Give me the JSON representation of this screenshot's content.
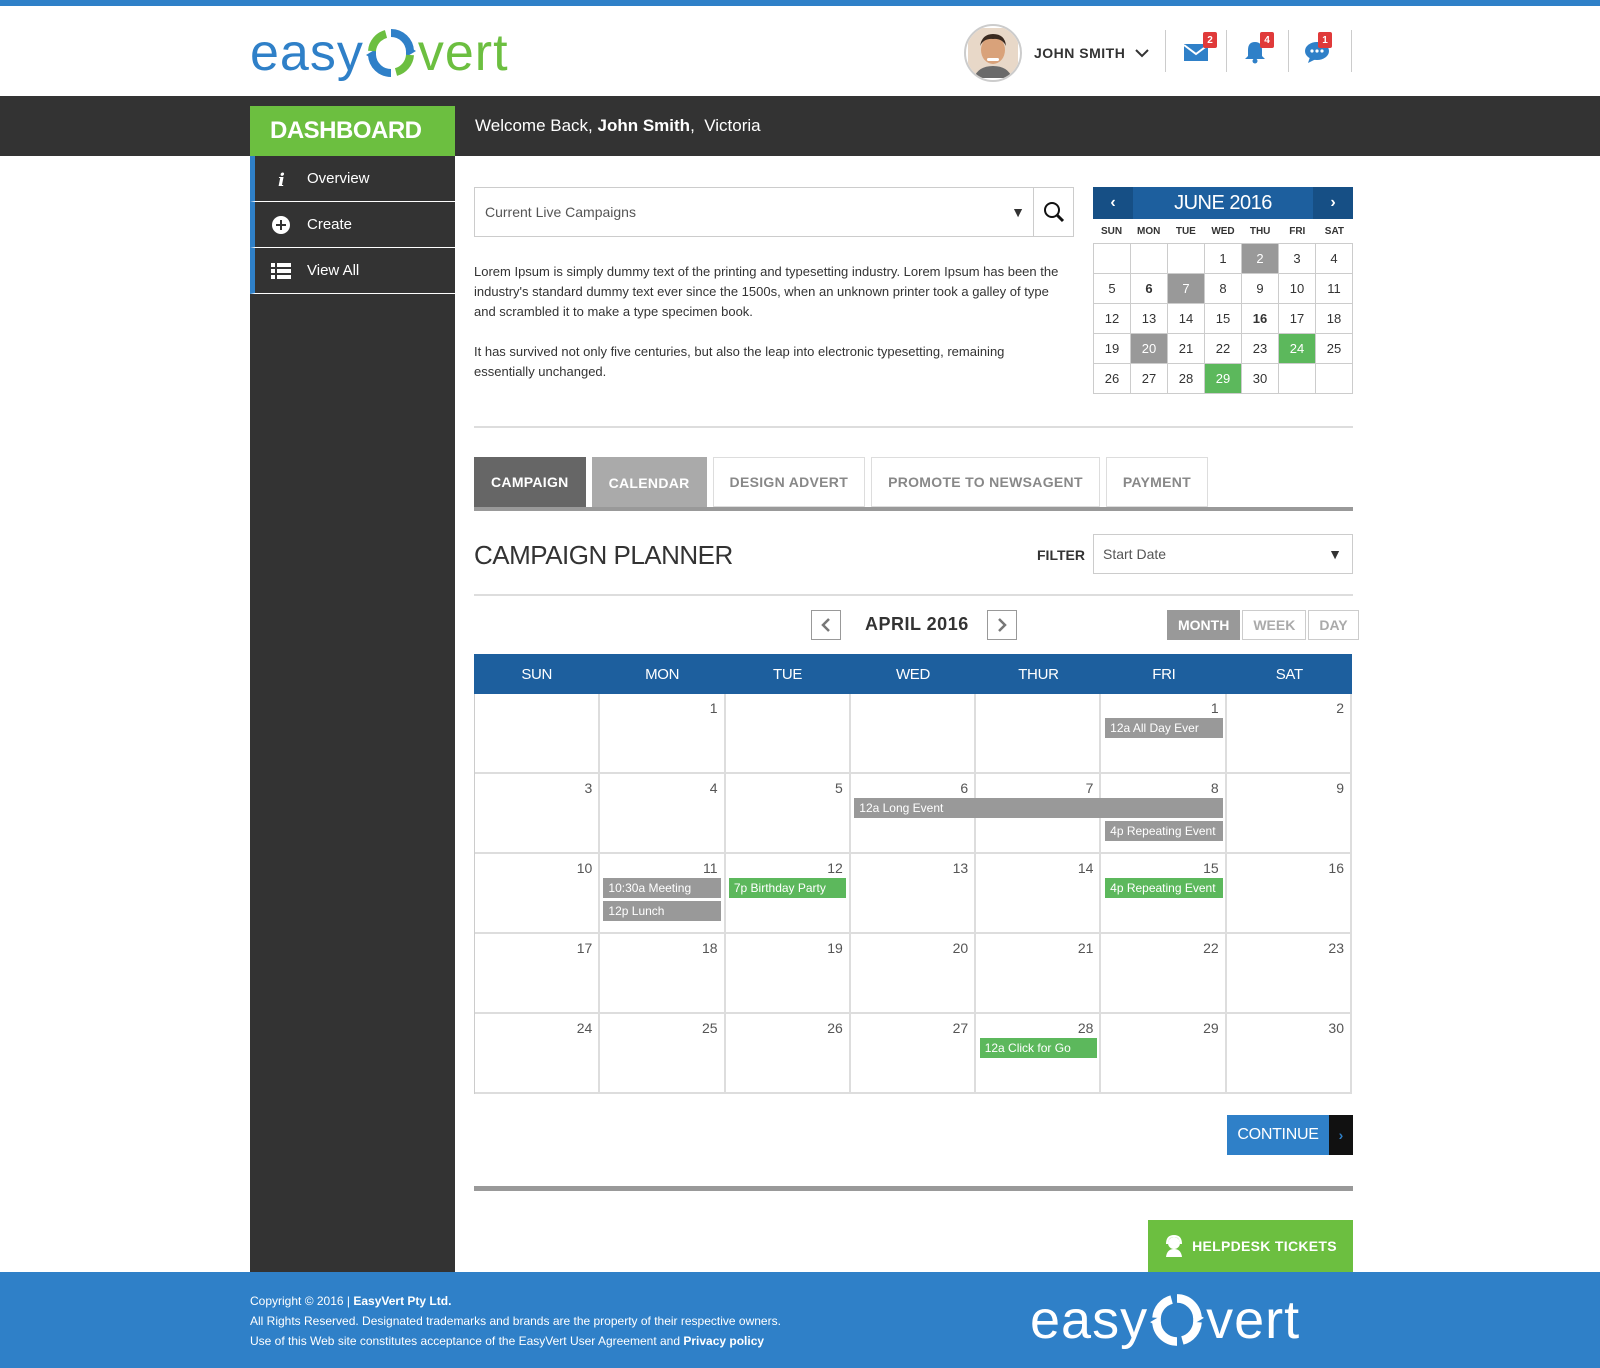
{
  "brand": {
    "easy": "easy",
    "vert": "vert",
    "blue": "#2f80c8",
    "green": "#6cbf40",
    "dark": "#333333"
  },
  "header": {
    "user_name": "JOHN SMITH",
    "badges": {
      "mail": "2",
      "bell": "4",
      "chat": "1"
    }
  },
  "topbar": {
    "dashboard_label": "DASHBOARD",
    "welcome_prefix": "Welcome Back,",
    "welcome_name": "John Smith",
    "welcome_location": "Victoria"
  },
  "sidebar": {
    "items": [
      {
        "label": "Overview",
        "icon": "info-icon"
      },
      {
        "label": "Create",
        "icon": "plus-circle-icon"
      },
      {
        "label": "View All",
        "icon": "list-icon"
      }
    ]
  },
  "search": {
    "value": "Current Live Campaigns"
  },
  "intro": {
    "p1": "Lorem Ipsum is simply dummy text of the printing and typesetting industry. Lorem Ipsum has been the industry's standard dummy text ever since the 1500s, when an unknown printer took a galley of type and scrambled it to make a type specimen book.",
    "p2": "It has survived not only five centuries, but also the leap into electronic typesetting, remaining essentially unchanged."
  },
  "mini_calendar": {
    "title": "JUNE 2016",
    "dow": [
      "SUN",
      "MON",
      "TUE",
      "WED",
      "THU",
      "FRI",
      "SAT"
    ],
    "cells": [
      {
        "d": "",
        "s": ""
      },
      {
        "d": "",
        "s": ""
      },
      {
        "d": "",
        "s": ""
      },
      {
        "d": "1",
        "s": ""
      },
      {
        "d": "2",
        "s": "gray"
      },
      {
        "d": "3",
        "s": ""
      },
      {
        "d": "4",
        "s": ""
      },
      {
        "d": "5",
        "s": ""
      },
      {
        "d": "6",
        "s": "bold"
      },
      {
        "d": "7",
        "s": "gray"
      },
      {
        "d": "8",
        "s": ""
      },
      {
        "d": "9",
        "s": ""
      },
      {
        "d": "10",
        "s": ""
      },
      {
        "d": "11",
        "s": ""
      },
      {
        "d": "12",
        "s": ""
      },
      {
        "d": "13",
        "s": ""
      },
      {
        "d": "14",
        "s": ""
      },
      {
        "d": "15",
        "s": ""
      },
      {
        "d": "16",
        "s": "bold"
      },
      {
        "d": "17",
        "s": ""
      },
      {
        "d": "18",
        "s": ""
      },
      {
        "d": "19",
        "s": ""
      },
      {
        "d": "20",
        "s": "gray"
      },
      {
        "d": "21",
        "s": ""
      },
      {
        "d": "22",
        "s": ""
      },
      {
        "d": "23",
        "s": ""
      },
      {
        "d": "24",
        "s": "green"
      },
      {
        "d": "25",
        "s": ""
      },
      {
        "d": "26",
        "s": ""
      },
      {
        "d": "27",
        "s": ""
      },
      {
        "d": "28",
        "s": ""
      },
      {
        "d": "29",
        "s": "green"
      },
      {
        "d": "30",
        "s": ""
      },
      {
        "d": "",
        "s": ""
      },
      {
        "d": "",
        "s": ""
      }
    ]
  },
  "tabs": [
    {
      "label": "CAMPAIGN",
      "state": "active"
    },
    {
      "label": "CALENDAR",
      "state": "cal"
    },
    {
      "label": "DESIGN ADVERT",
      "state": ""
    },
    {
      "label": "PROMOTE TO NEWSAGENT",
      "state": ""
    },
    {
      "label": "PAYMENT",
      "state": ""
    }
  ],
  "planner": {
    "title": "CAMPAIGN PLANNER",
    "filter_label": "FILTER",
    "filter_value": "Start Date",
    "month": "APRIL 2016",
    "views": [
      "MONTH",
      "WEEK",
      "DAY"
    ],
    "active_view": "MONTH"
  },
  "big_calendar": {
    "dow": [
      "SUN",
      "MON",
      "TUE",
      "WED",
      "THUR",
      "FRI",
      "SAT"
    ],
    "days": [
      "",
      "1",
      "",
      "",
      "",
      "1",
      "2",
      "3",
      "4",
      "5",
      "6",
      "7",
      "8",
      "9",
      "10",
      "11",
      "12",
      "13",
      "14",
      "15",
      "16",
      "17",
      "18",
      "19",
      "20",
      "21",
      "22",
      "23",
      "24",
      "25",
      "26",
      "27",
      "28",
      "29",
      "30"
    ],
    "events": [
      {
        "label": "12a All Day Ever",
        "color": "gray",
        "week": 0,
        "col": 5,
        "span": 1,
        "slot": 0
      },
      {
        "label": "12a Long Event",
        "color": "gray",
        "week": 1,
        "col": 3,
        "span": 3,
        "slot": 0
      },
      {
        "label": "4p Repeating Event",
        "color": "gray",
        "week": 1,
        "col": 5,
        "span": 1,
        "slot": 1
      },
      {
        "label": "10:30a Meeting",
        "color": "gray",
        "week": 2,
        "col": 1,
        "span": 1,
        "slot": 0
      },
      {
        "label": "12p Lunch",
        "color": "gray",
        "week": 2,
        "col": 1,
        "span": 1,
        "slot": 1
      },
      {
        "label": "7p Birthday Party",
        "color": "green",
        "week": 2,
        "col": 2,
        "span": 1,
        "slot": 0
      },
      {
        "label": "4p Repeating Event",
        "color": "green",
        "week": 2,
        "col": 5,
        "span": 1,
        "slot": 0
      },
      {
        "label": "12a Click for Go",
        "color": "green",
        "week": 4,
        "col": 4,
        "span": 1,
        "slot": 0
      }
    ]
  },
  "continue_label": "CONTINUE",
  "helpdesk_label": "HELPDESK TICKETS",
  "footer": {
    "copyright_prefix": "Copyright © 2016 |",
    "company": "EasyVert Pty Ltd.",
    "line2": "All Rights Reserved. Designated trademarks and brands are the property of their respective owners.",
    "line3_prefix": "Use of this Web site constitutes acceptance of the EasyVert User Agreement and",
    "privacy_link": "Privacy policy"
  }
}
